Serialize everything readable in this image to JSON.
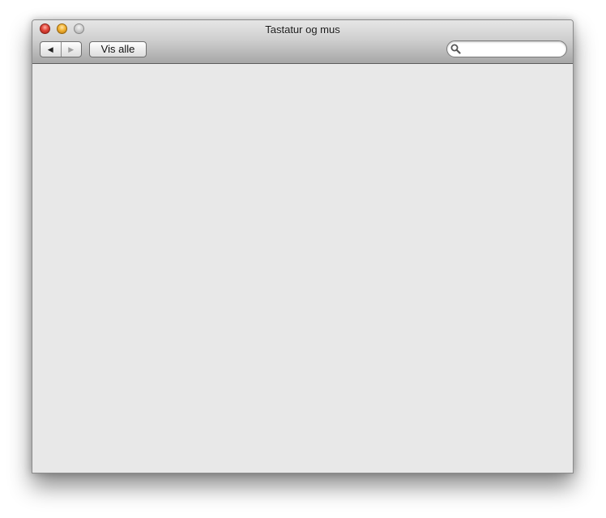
{
  "window": {
    "title": "Tastatur og mus"
  },
  "toolbar": {
    "back_icon": "◀",
    "forward_icon": "▶",
    "show_all_label": "Vis alle"
  },
  "search": {
    "value": "",
    "placeholder": "",
    "icon": "search-icon"
  },
  "colors": {
    "close": "#e0453a",
    "minimize": "#f2b233",
    "zoom": "#cdcdcd",
    "content_background": "#e8e8e8"
  }
}
